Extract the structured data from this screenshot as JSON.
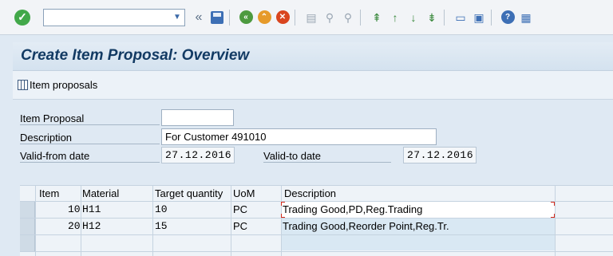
{
  "toolbar": {
    "command_value": "",
    "icons": [
      "enter-check",
      "dropdown",
      "collapse-left",
      "save",
      "back",
      "exit",
      "cancel",
      "print",
      "find",
      "find-next",
      "first-page",
      "previous-page",
      "next-page",
      "last-page",
      "create-session",
      "shortcut",
      "help",
      "customize-layout"
    ]
  },
  "title": "Create Item Proposal: Overview",
  "app_toolbar": {
    "item_proposals_label": "Item proposals"
  },
  "form": {
    "item_proposal_label": "Item Proposal",
    "item_proposal_value": "",
    "description_label": "Description",
    "description_value": "For Customer 491010",
    "valid_from_label": "Valid-from date",
    "valid_from_value": "27.12.2016",
    "valid_to_label": "Valid-to date",
    "valid_to_value": "27.12.2016"
  },
  "table": {
    "headers": {
      "item": "Item",
      "material": "Material",
      "target_quantity": "Target quantity",
      "uom": "UoM",
      "description": "Description"
    },
    "rows": [
      {
        "item": "10",
        "material": "H11",
        "target_quantity": "10",
        "uom": "PC",
        "description": "Trading Good,PD,Reg.Trading"
      },
      {
        "item": "20",
        "material": "H12",
        "target_quantity": "15",
        "uom": "PC",
        "description": "Trading Good,Reorder Point,Reg.Tr."
      }
    ]
  },
  "colors": {
    "accent": "#123a63",
    "background": "#dfe9f3",
    "focus_marker": "#d32a1b"
  }
}
